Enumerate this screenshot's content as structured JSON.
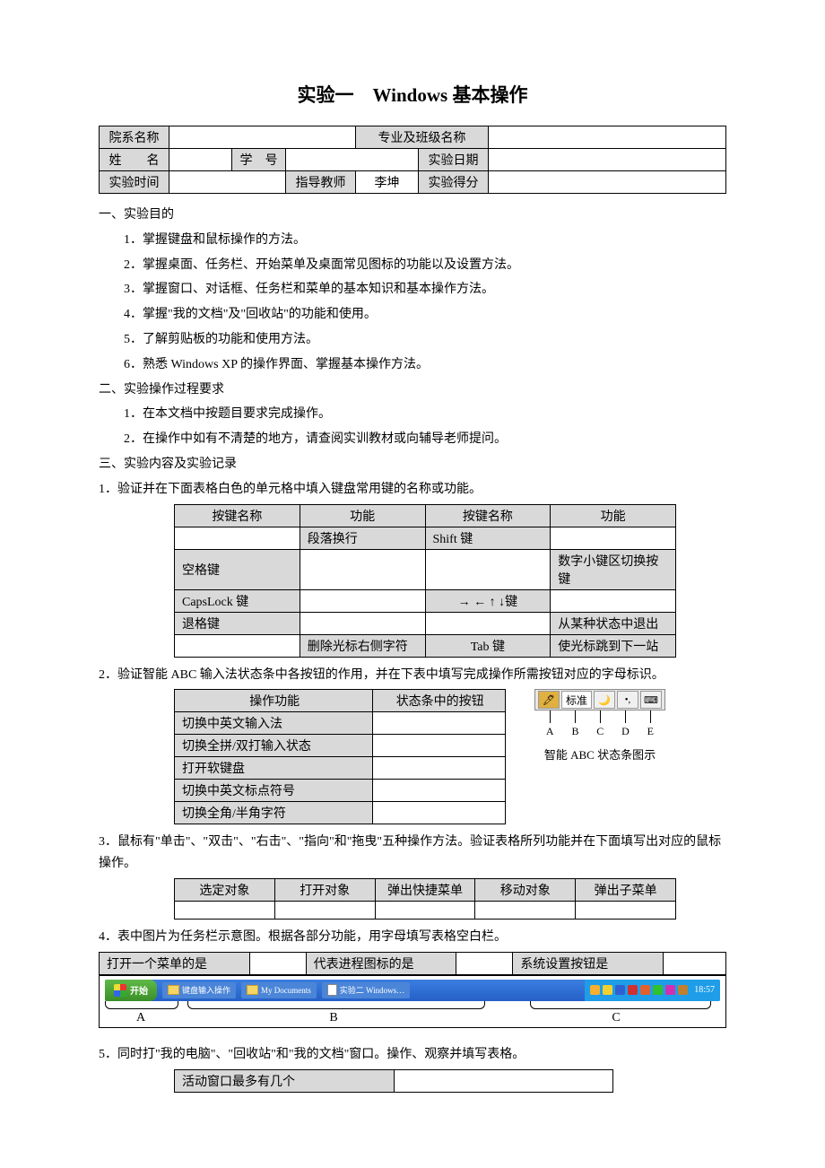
{
  "title_prefix": "实验一",
  "title_win": "Windows",
  "title_suffix": "基本操作",
  "hdr": {
    "dept": "院系名称",
    "class": "专业及班级名称",
    "name": "姓　　名",
    "sid": "学　号",
    "exp_date": "实验日期",
    "exp_time": "实验时间",
    "teacher_lbl": "指导教师",
    "teacher_val": "李坤",
    "score": "实验得分"
  },
  "s1": {
    "h": "一、实验目的",
    "i1": "1．掌握键盘和鼠标操作的方法。",
    "i2": "2．掌握桌面、任务栏、开始菜单及桌面常见图标的功能以及设置方法。",
    "i3": "3．掌握窗口、对话框、任务栏和菜单的基本知识和基本操作方法。",
    "i4": "4．掌握\"我的文档\"及\"回收站\"的功能和使用。",
    "i5": "5．了解剪贴板的功能和使用方法。",
    "i6": "6．熟悉 Windows XP 的操作界面、掌握基本操作方法。"
  },
  "s2": {
    "h": "二、实验操作过程要求",
    "i1": "1．在本文档中按题目要求完成操作。",
    "i2": "2．在操作中如有不清楚的地方，请查阅实训教材或向辅导老师提问。"
  },
  "s3h": "三、实验内容及实验记录",
  "q1": {
    "t": "1．验证并在下面表格白色的单元格中填入键盘常用键的名称或功能。",
    "h1": "按键名称",
    "h2": "功能",
    "h3": "按键名称",
    "h4": "功能",
    "r1c2": "段落换行",
    "r1c3": "Shift 键",
    "r2c1": "空格键",
    "r2c4": "数字小键区切换按键",
    "r3c1": "CapsLock 键",
    "r3c3": "→ ← ↑ ↓键",
    "r4c1": "退格键",
    "r4c4": "从某种状态中退出",
    "r5c2": "删除光标右侧字符",
    "r5c3": "Tab 键",
    "r5c4": "使光标跳到下一站"
  },
  "q2": {
    "t": "2．验证智能 ABC 输入法状态条中各按钮的作用，并在下表中填写完成操作所需按钮对应的字母标识。",
    "h1": "操作功能",
    "h2": "状态条中的按钮",
    "r1": "切换中英文输入法",
    "r2": "切换全拼/双打输入状态",
    "r3": "打开软键盘",
    "r4": "切换中英文标点符号",
    "r5": "切换全角/半角字符",
    "fig_std": "标准",
    "fig_a": "A",
    "fig_b": "B",
    "fig_c": "C",
    "fig_d": "D",
    "fig_e": "E",
    "fig_cap": "智能 ABC 状态条图示"
  },
  "q3": {
    "t": "3．鼠标有\"单击\"、\"双击\"、\"右击\"、\"指向\"和\"拖曳\"五种操作方法。验证表格所列功能并在下面填写出对应的鼠标操作。",
    "c1": "选定对象",
    "c2": "打开对象",
    "c3": "弹出快捷菜单",
    "c4": "移动对象",
    "c5": "弹出子菜单"
  },
  "q4": {
    "t": "4．表中图片为任务栏示意图。根据各部分功能，用字母填写表格空白栏。",
    "l1": "打开一个菜单的是",
    "l2": "代表进程图标的是",
    "l3": "系统设置按钮是",
    "tb_start": "开始",
    "tb_i1": "键盘输入操作",
    "tb_i2": "My Documents",
    "tb_i3": "实验二 Windows…",
    "tb_time": "18:57",
    "a": "A",
    "b": "B",
    "c": "C"
  },
  "q5": {
    "t": "5．同时打\"我的电脑\"、\"回收站\"和\"我的文档\"窗口。操作、观察并填写表格。",
    "r1": "活动窗口最多有几个"
  }
}
